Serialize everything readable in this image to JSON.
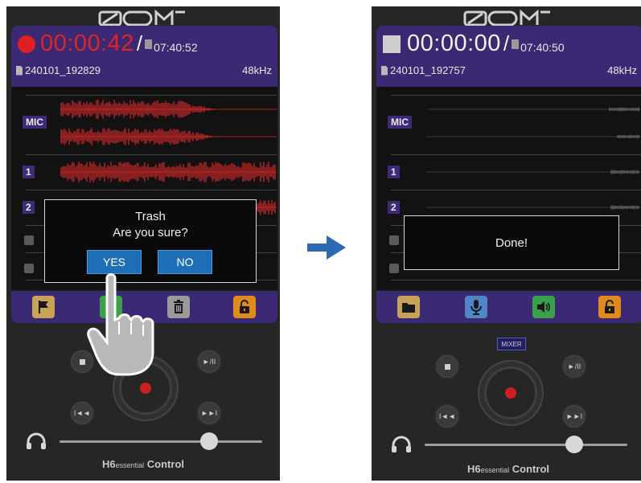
{
  "logo_text": "ZOOM",
  "left_screen": {
    "status": "recording",
    "elapsed_time": "00:00:42",
    "remaining_time": "07:40:52",
    "filename": "240101_192829",
    "sample_rate": "48kHz",
    "tracks": [
      {
        "label": "MIC"
      },
      {
        "label": "1"
      },
      {
        "label": "2"
      }
    ],
    "dialog": {
      "title": "Trash",
      "message": "Are you sure?",
      "yes_label": "YES",
      "no_label": "NO"
    },
    "toolbar": [
      "flag-icon",
      "mic-icon",
      "trash-icon",
      "lock-icon"
    ]
  },
  "right_screen": {
    "status": "stopped",
    "elapsed_time": "00:00:00",
    "remaining_time": "07:40:50",
    "filename": "240101_192757",
    "sample_rate": "48kHz",
    "tracks": [
      {
        "label": "MIC"
      },
      {
        "label": "1"
      },
      {
        "label": "2"
      }
    ],
    "dialog": {
      "message": "Done!"
    },
    "toolbar": [
      "folder-icon",
      "mic-icon",
      "speaker-icon",
      "lock-icon"
    ],
    "mixer_label": "MIXER"
  },
  "brand": {
    "model": "H6",
    "model_suffix": "essential",
    "app": "Control"
  },
  "headphone_volume_fraction": 0.74,
  "colors": {
    "accent_purple": "#3b2a73",
    "record_red": "#e02424",
    "waveform_red": "#d42a2a",
    "button_blue": "#1f6fb8",
    "flag_tan": "#c9a25a",
    "mic_blue": "#4f86c6",
    "speaker_green": "#3aa04a",
    "lock_orange": "#e08a1e",
    "trash_gray": "#9a9a9a"
  }
}
